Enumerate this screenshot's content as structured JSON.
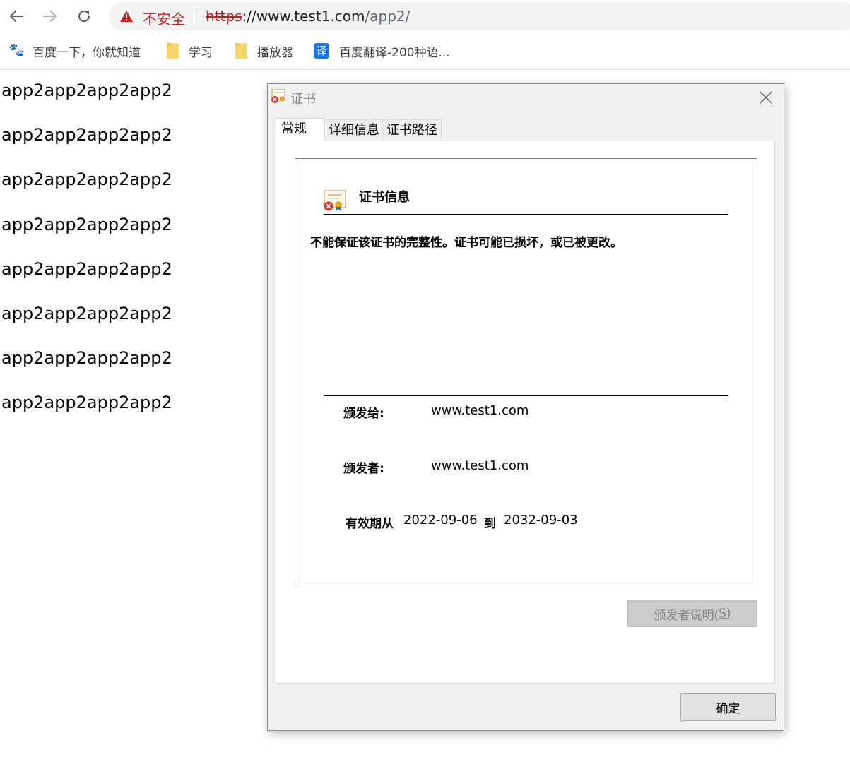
{
  "browser": {
    "security_label": "不安全",
    "url_scheme": "https",
    "url_rest_host": "://www.test1.com",
    "url_path": "/app2/",
    "bookmarks": [
      {
        "label": "百度一下，你就知道",
        "icon": "baidu-paw-icon"
      },
      {
        "label": "学习",
        "icon": "folder-icon"
      },
      {
        "label": "播放器",
        "icon": "folder-icon"
      },
      {
        "label": "百度翻译-200种语...",
        "icon": "translate-icon",
        "icon_text": "译"
      }
    ]
  },
  "page": {
    "lines": [
      "app2app2app2app2",
      "app2app2app2app2",
      "app2app2app2app2",
      "app2app2app2app2",
      "app2app2app2app2",
      "app2app2app2app2",
      "app2app2app2app2",
      "app2app2app2app2"
    ]
  },
  "dialog": {
    "title": "证书",
    "tabs": [
      "常规",
      "详细信息",
      "证书路径"
    ],
    "active_tab": "常规",
    "info_heading": "证书信息",
    "warning": "不能保证该证书的完整性。证书可能已损坏，或已被更改。",
    "issued_to_label": "颁发给:",
    "issued_to_value": "www.test1.com",
    "issued_by_label": "颁发者:",
    "issued_by_value": "www.test1.com",
    "valid_from_label": "有效期从",
    "valid_from_value": "2022-09-06",
    "valid_to_label": "到",
    "valid_to_value": "2032-09-03",
    "issuer_statement_button": "颁发者说明(",
    "issuer_statement_key": "S",
    "issuer_statement_tail": ")",
    "ok_button": "确定"
  },
  "colors": {
    "not_secure_red": "#c5221f",
    "dialog_bg": "#f0f0f0",
    "disabled_button_bg": "#cccccc"
  }
}
